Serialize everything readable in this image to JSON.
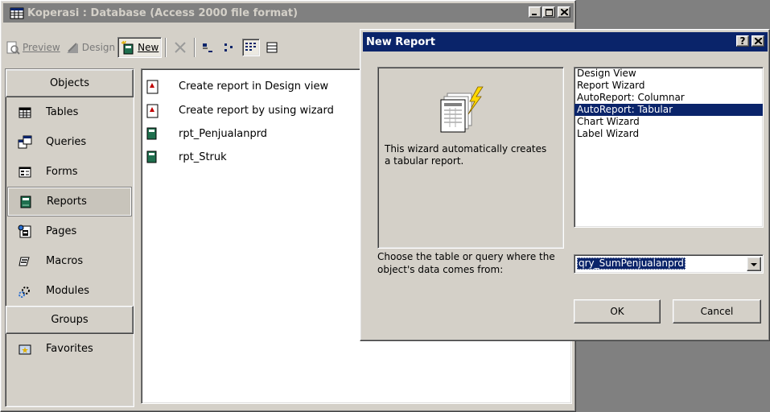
{
  "db_window": {
    "title": "Koperasi : Database (Access 2000 file format)",
    "toolbar": {
      "preview": "Preview",
      "design": "Design",
      "new": "New"
    }
  },
  "objects_pane": {
    "objects_header": "Objects",
    "items": [
      {
        "label": "Tables",
        "icon": "table-icon"
      },
      {
        "label": "Queries",
        "icon": "query-icon"
      },
      {
        "label": "Forms",
        "icon": "form-icon"
      },
      {
        "label": "Reports",
        "icon": "report-icon",
        "selected": true
      },
      {
        "label": "Pages",
        "icon": "page-icon"
      },
      {
        "label": "Macros",
        "icon": "macro-icon"
      },
      {
        "label": "Modules",
        "icon": "module-icon"
      }
    ],
    "groups_header": "Groups",
    "favorites": "Favorites"
  },
  "list_pane": {
    "items": [
      "Create report in Design view",
      "Create report by using wizard",
      "rpt_Penjualanprd",
      "rpt_Struk"
    ]
  },
  "dialog": {
    "title": "New Report",
    "help_button": "?",
    "close_button": "X",
    "description": "This wizard automatically creates a tabular report.",
    "wizard_options": [
      "Design View",
      "Report Wizard",
      "AutoReport:  Columnar",
      "AutoReport:  Tabular",
      "Chart Wizard",
      "Label Wizard"
    ],
    "selected_option": "AutoReport:  Tabular",
    "source_label": "Choose the table or query where the object's data comes from:",
    "source_value": "qry_SumPenjualanprd",
    "ok": "OK",
    "cancel": "Cancel"
  },
  "colors": {
    "active_title": "#0a246a",
    "inactive_title": "#808080",
    "face": "#d4d0c8"
  }
}
